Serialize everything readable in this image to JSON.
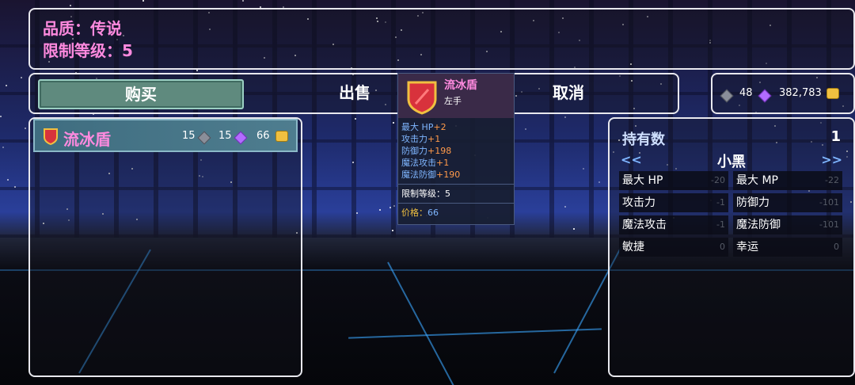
{
  "item_info": {
    "quality": "品质：传说",
    "level_req": "限制等级：5"
  },
  "actions": {
    "buy": "购买",
    "sell": "出售",
    "cancel": "取消"
  },
  "currency": {
    "dark_gem": "48",
    "gold": "382,783"
  },
  "shop_list": [
    {
      "name": "流冰盾",
      "dark_gem_cost": "15",
      "purple_gem_cost": "15",
      "gold_cost": "66"
    }
  ],
  "tooltip": {
    "name": "流冰盾",
    "slot": "左手",
    "stats": [
      {
        "label": "最大 HP",
        "value": "+2"
      },
      {
        "label": "攻击力",
        "value": "+1"
      },
      {
        "label": "防御力",
        "value": "+198"
      },
      {
        "label": "魔法攻击",
        "value": "+1"
      },
      {
        "label": "魔法防御",
        "value": "+190"
      }
    ],
    "level_req": "限制等级：5",
    "price_label": "价格：",
    "price_value": "66"
  },
  "character": {
    "owned_label": "持有数",
    "owned_count": "1",
    "prev": "<<",
    "next": ">>",
    "name": "小黑",
    "stats": [
      {
        "left_label": "最大 HP",
        "left_value": "-20",
        "right_label": "最大 MP",
        "right_value": "-22"
      },
      {
        "left_label": "攻击力",
        "left_value": "-1",
        "right_label": "防御力",
        "right_value": "-101"
      },
      {
        "left_label": "魔法攻击",
        "left_value": "-1",
        "right_label": "魔法防御",
        "right_value": "-101"
      },
      {
        "left_label": "敏捷",
        "left_value": "0",
        "right_label": "幸运",
        "right_value": "0"
      }
    ]
  },
  "colors": {
    "pink_text": "#ff8adf",
    "buy_button": "#5f8a7e",
    "stat_bonus_blue": "#7fb6ff",
    "stat_bonus_orange": "#ff9a4a",
    "price_gold": "#f0c040"
  }
}
